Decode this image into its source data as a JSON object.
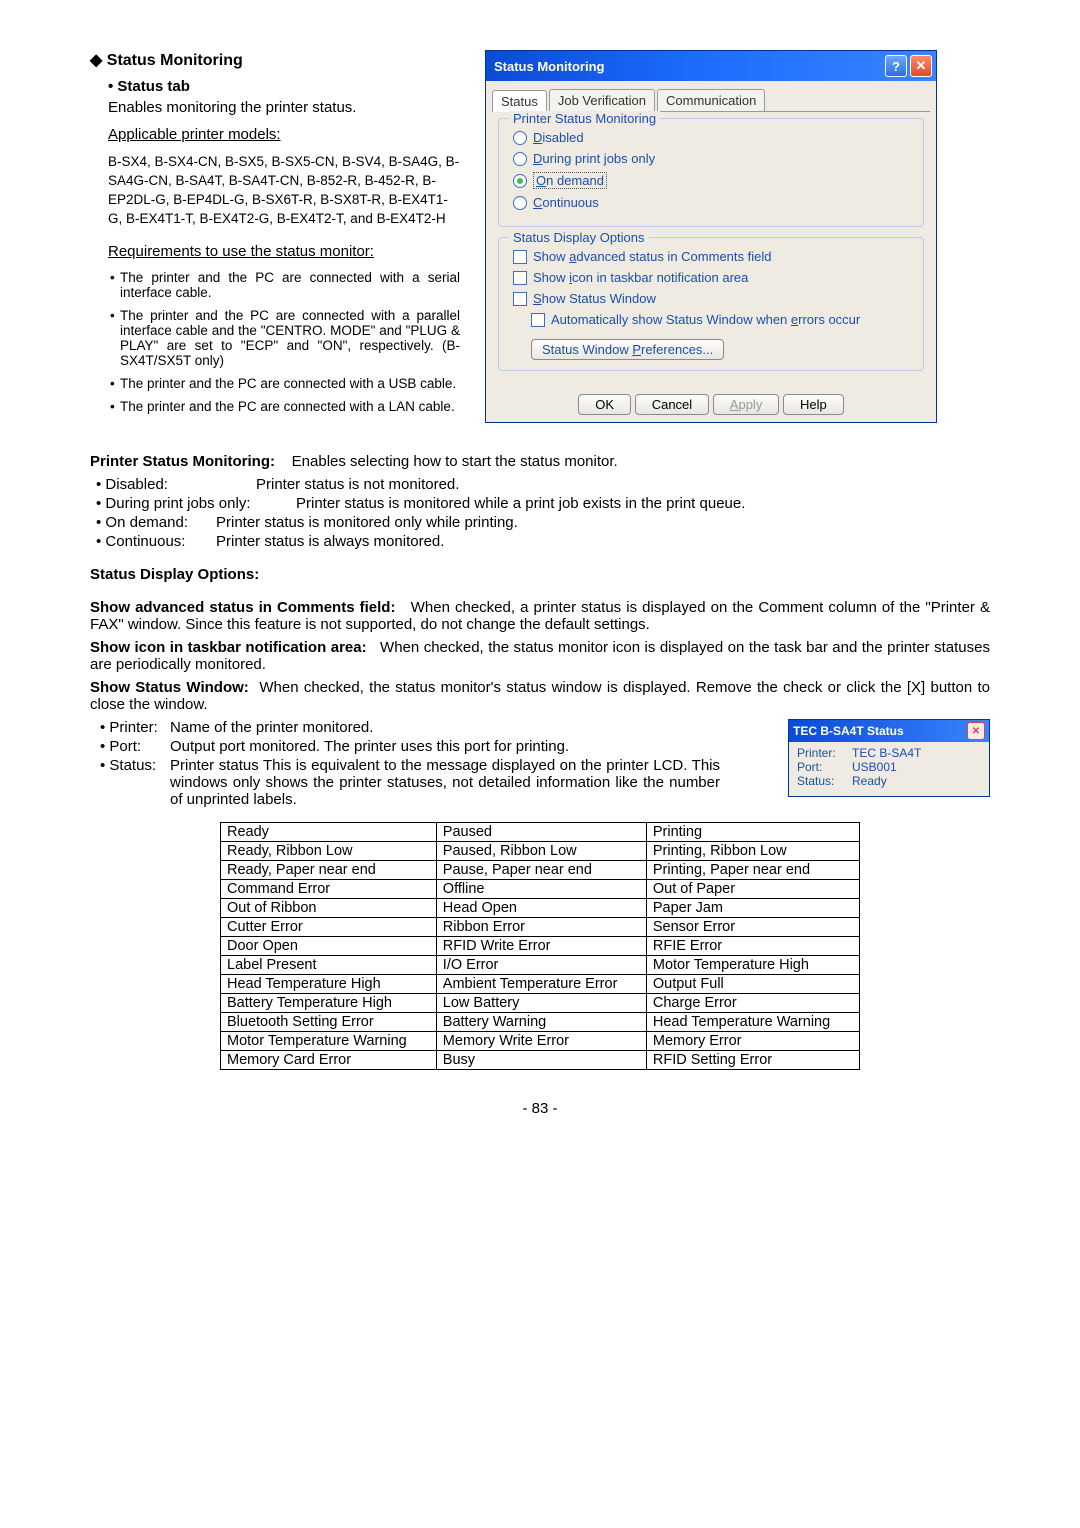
{
  "section": {
    "title": "Status Monitoring",
    "status_tab_label": "Status tab",
    "status_tab_desc": "Enables monitoring the printer status.",
    "applicable_label": "Applicable printer models:",
    "applicable_models": "B-SX4, B-SX4-CN, B-SX5, B-SX5-CN, B-SV4, B-SA4G, B-SA4G-CN, B-SA4T, B-SA4T-CN, B-852-R, B-452-R, B-EP2DL-G, B-EP4DL-G, B-SX6T-R, B-SX8T-R, B-EX4T1-G, B-EX4T1-T, B-EX4T2-G, B-EX4T2-T, and B-EX4T2-H",
    "req_label": "Requirements to use the status monitor:",
    "req_bullets": [
      "The printer and the PC are connected with a serial interface cable.",
      "The printer and the PC are connected with a parallel interface cable and the \"CENTRO. MODE\" and \"PLUG & PLAY\" are set to \"ECP\" and \"ON\", respectively.   (B-SX4T/SX5T only)",
      "The printer and the PC are connected with a USB cable.",
      "The printer and the PC are connected with a LAN cable."
    ]
  },
  "dialog": {
    "title": "Status Monitoring",
    "tabs": [
      "Status",
      "Job Verification",
      "Communication"
    ],
    "group1_title": "Printer Status Monitoring",
    "radio_disabled": "isabled",
    "radio_during": "uring print jobs only",
    "radio_ondemand": "On demand",
    "radio_continuous": "ontinuous",
    "group2_title": "Status Display Options",
    "chk_adv": "Show advanced status in Comments field",
    "chk_icon": "Show icon in taskbar notification area",
    "chk_window": "how Status Window",
    "chk_auto": "Automatically show Status Window when errors occur",
    "pref_btn": "Status Window Preferences...",
    "ok": "OK",
    "cancel": "Cancel",
    "apply": "Apply",
    "help": "Help"
  },
  "psm": {
    "heading": "Printer Status Monitoring:",
    "desc": "Enables selecting how to start the status monitor.",
    "items": [
      {
        "lbl": "• Disabled:",
        "txt": "Printer status is not monitored."
      },
      {
        "lbl": "• During print jobs only:",
        "txt": "Printer status is monitored while a print job exists in the print queue."
      },
      {
        "lbl": "• On demand:",
        "txt": "Printer status is monitored only while printing."
      },
      {
        "lbl": "• Continuous:",
        "txt": "Printer status is always monitored."
      }
    ]
  },
  "sdo": {
    "heading": "Status Display Options:",
    "p_adv_lbl": "Show advanced status in Comments field:",
    "p_adv_txt": "When checked, a printer status is displayed on the Comment column of the \"Printer & FAX\" window.  Since this feature is not supported, do not change the default settings.",
    "p_icon_lbl": "Show icon in taskbar notification area:",
    "p_icon_txt": "When checked, the status monitor icon is displayed on the task bar and the printer statuses are periodically monitored.",
    "p_win_lbl": "Show Status Window:",
    "p_win_txt": "When checked, the status monitor's status window is displayed.  Remove the check or click the [X] button to close the window.",
    "items": [
      {
        "lbl": "• Printer:",
        "txt": "Name of the printer monitored."
      },
      {
        "lbl": "• Port:",
        "txt": "Output port monitored.   The printer uses this port for printing."
      },
      {
        "lbl": "• Status:",
        "txt": "Printer status   This is equivalent to the message displayed on the printer LCD.   This windows only shows the printer statuses, not detailed information like the number of unprinted labels."
      }
    ]
  },
  "status_win": {
    "title": "TEC B-SA4T Status",
    "printer_lbl": "Printer:",
    "printer_val": "TEC B-SA4T",
    "port_lbl": "Port:",
    "port_val": "USB001",
    "status_lbl": "Status:",
    "status_val": "Ready"
  },
  "status_table": [
    [
      "Ready",
      "Paused",
      "Printing"
    ],
    [
      "Ready, Ribbon Low",
      "Paused, Ribbon Low",
      "Printing, Ribbon Low"
    ],
    [
      "Ready, Paper near end",
      "Pause, Paper near end",
      "Printing, Paper near end"
    ],
    [
      "Command Error",
      "Offline",
      "Out of Paper"
    ],
    [
      "Out of Ribbon",
      "Head Open",
      "Paper Jam"
    ],
    [
      "Cutter Error",
      "Ribbon Error",
      "Sensor Error"
    ],
    [
      "Door Open",
      "RFID Write Error",
      "RFIE Error"
    ],
    [
      "Label Present",
      "I/O Error",
      "Motor Temperature High"
    ],
    [
      "Head Temperature High",
      "Ambient Temperature Error",
      "Output Full"
    ],
    [
      "Battery Temperature High",
      "Low Battery",
      "Charge Error"
    ],
    [
      "Bluetooth Setting Error",
      "Battery Warning",
      "Head Temperature Warning"
    ],
    [
      "Motor Temperature Warning",
      "Memory Write Error",
      "Memory Error"
    ],
    [
      "Memory Card Error",
      "Busy",
      "RFID Setting Error"
    ]
  ],
  "page_number": "- 83 -"
}
